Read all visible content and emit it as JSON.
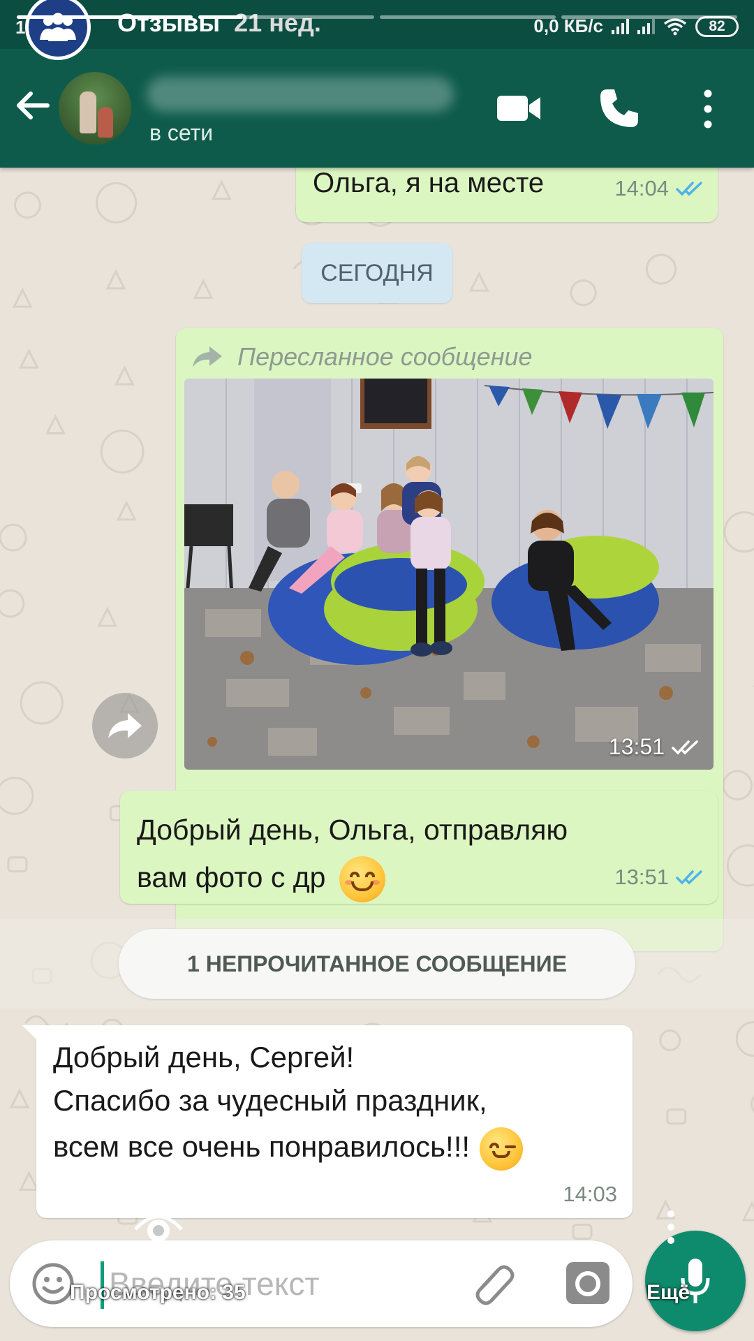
{
  "status_bar": {
    "time": "14:04",
    "network_speed": "0,0 КБ/с",
    "battery": "82"
  },
  "story": {
    "title": "Отзывы",
    "age": "21 нед.",
    "views_label": "Просмотрено: 35",
    "more_label": "Ещё",
    "segments_progress": [
      1,
      0.25,
      0,
      0
    ]
  },
  "header": {
    "contact_status": "в сети",
    "icons": [
      "back-arrow-icon",
      "video-call-icon",
      "phone-icon",
      "more-vert-icon"
    ]
  },
  "messages": {
    "first": {
      "text": "Ольга, я на месте",
      "time": "14:04",
      "status": "read"
    },
    "date_chip": "СЕГОДНЯ",
    "forwarded": {
      "label": "Пересланное сообщение",
      "photo_time": "13:51",
      "status": "read"
    },
    "second": {
      "line1": "Добрый день, Ольга, отправляю",
      "line2": "вам фото с др",
      "time": "13:51",
      "status": "read"
    },
    "unread_chip": "1 НЕПРОЧИТАННОЕ СООБЩЕНИЕ",
    "incoming": {
      "line1": "Добрый день, Сергей!",
      "line2": "Спасибо за чудесный праздник,",
      "line3": "всем все очень понравилось!!!",
      "time": "14:03"
    }
  },
  "input": {
    "placeholder": "Введите текст"
  },
  "colors": {
    "header": "#0e5b4c",
    "status_bar": "#0c4d42",
    "outgoing_bubble": "#dcf6c2",
    "incoming_bubble": "#ffffff",
    "read_tick": "#4fb3e8",
    "mic_button": "#0e8a6c",
    "story_badge": "#1e3e86"
  }
}
